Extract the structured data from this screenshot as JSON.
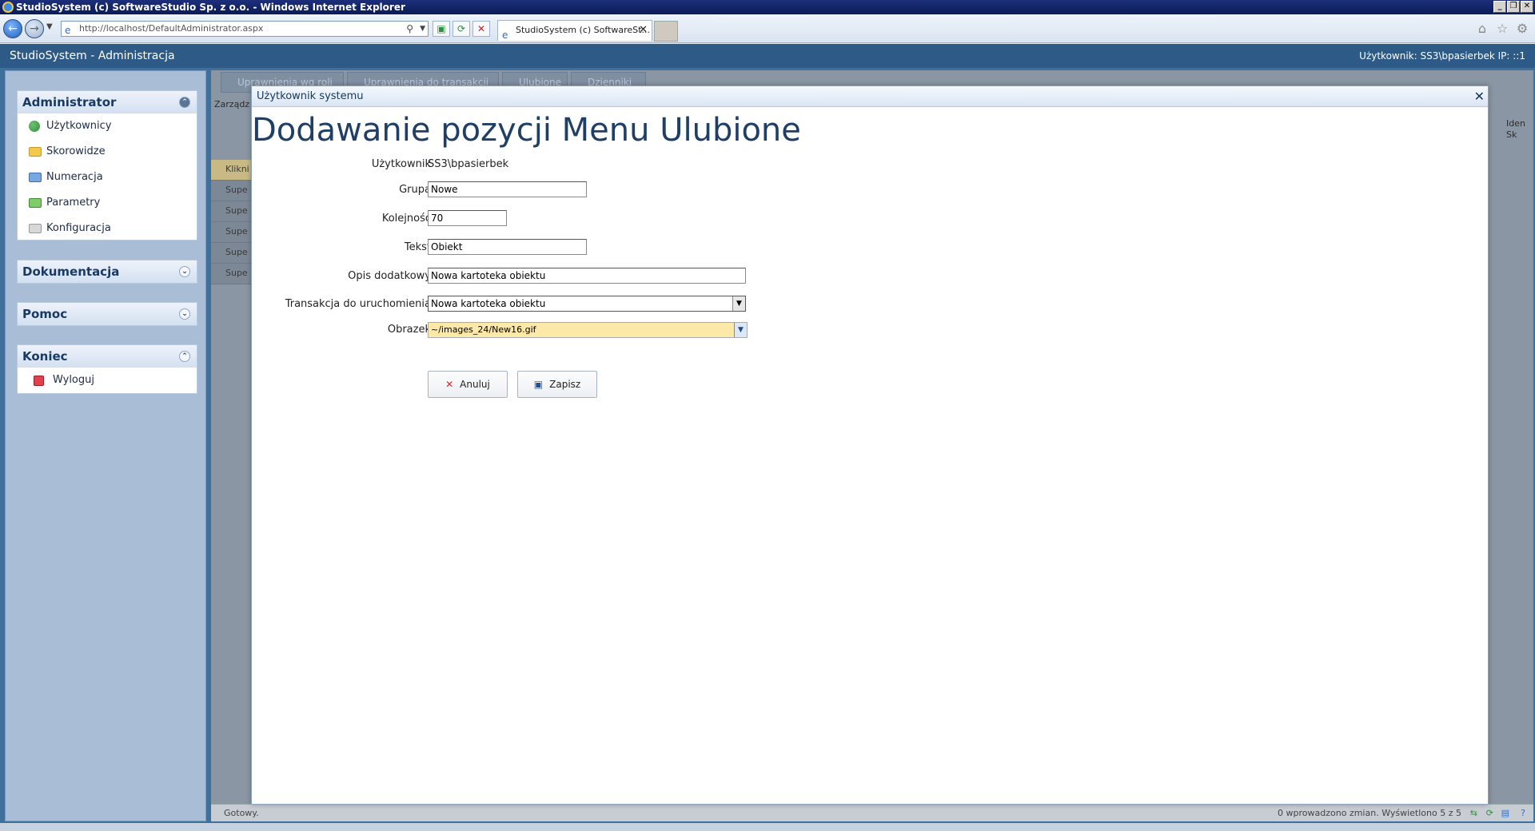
{
  "browser": {
    "window_title": "StudioSystem (c) SoftwareStudio Sp. z o.o. - Windows Internet Explorer",
    "address": "http://localhost/DefaultAdministrator.aspx",
    "tab_title": "StudioSystem (c) SoftwareSt..."
  },
  "app": {
    "title": "StudioSystem - Administracja",
    "user_info": "Użytkownik: SS3\\bpasierbek IP: ::1"
  },
  "sidebar": {
    "panels": [
      {
        "title": "Administrator",
        "items": [
          "Użytkownicy",
          "Skorowidze",
          "Numeracja",
          "Parametry",
          "Konfiguracja"
        ]
      },
      {
        "title": "Dokumentacja",
        "items": []
      },
      {
        "title": "Pomoc",
        "items": []
      },
      {
        "title": "Koniec",
        "items": [
          "Wyloguj"
        ]
      }
    ]
  },
  "background": {
    "tabs": [
      "Uprawnienia wg roli",
      "Uprawnienia do transakcji",
      "Ulubione",
      "Dzienniki"
    ],
    "breadcrumb": "Zarządz",
    "row_prefix": "Klikni",
    "rows": [
      "Supe",
      "Supe",
      "Supe",
      "Supe",
      "Supe"
    ],
    "col_header": "Iden Sk"
  },
  "status": {
    "left": "Gotowy.",
    "right": "0 wprowadzono zmian.   Wyświetlono 5 z 5"
  },
  "dialog": {
    "header": "Użytkownik systemu",
    "title": "Dodawanie pozycji Menu Ulubione",
    "fields": {
      "uzytkownik_label": "Użytkownik",
      "uzytkownik_value": "SS3\\bpasierbek",
      "grupa_label": "Grupa",
      "grupa_value": "Nowe",
      "kolejnosc_label": "Kolejność",
      "kolejnosc_value": "70",
      "tekst_label": "Tekst",
      "tekst_value": "Obiekt",
      "opis_label": "Opis dodatkowy",
      "opis_value": "Nowa kartoteka obiektu",
      "transakcja_label": "Transakcja do uruchomienia",
      "transakcja_value": "Nowa kartoteka obiektu",
      "obrazek_label": "Obrazek",
      "obrazek_value": "~/images_24/New16.gif"
    },
    "buttons": {
      "cancel": "Anuluj",
      "save": "Zapisz"
    }
  }
}
